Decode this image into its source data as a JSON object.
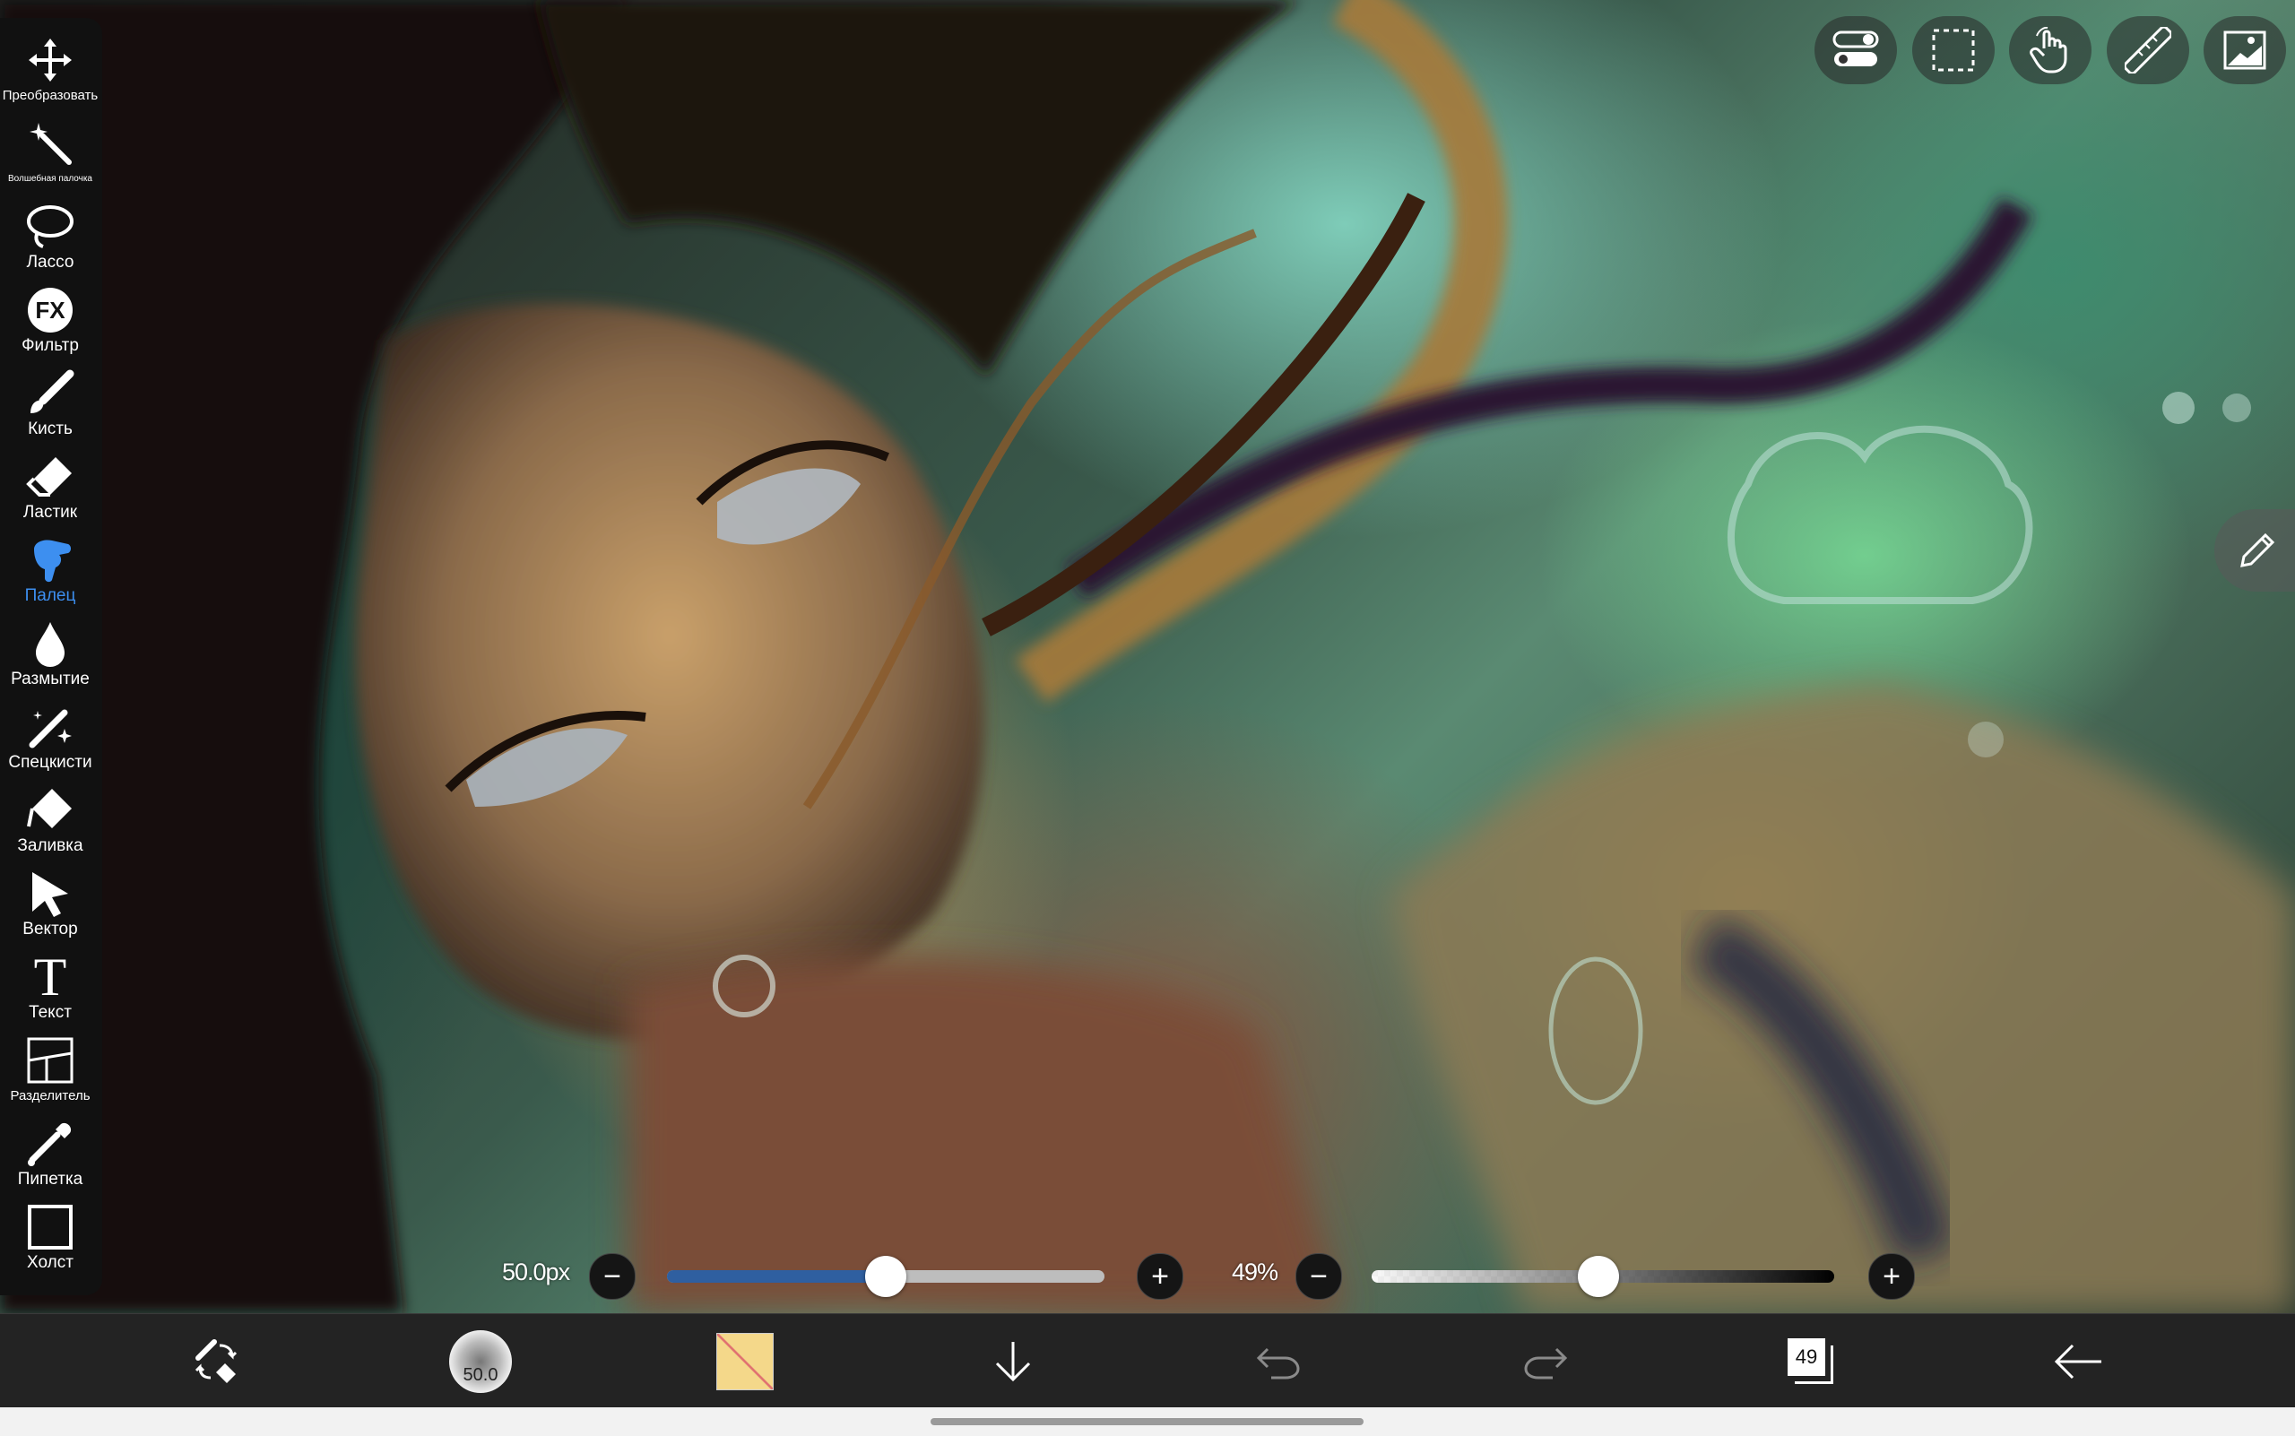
{
  "toolbar": {
    "tools": [
      {
        "label": "Преобразовать",
        "icon": "move-icon"
      },
      {
        "label": "Волшебная палочка",
        "icon": "magic-wand-icon"
      },
      {
        "label": "Лассо",
        "icon": "lasso-icon"
      },
      {
        "label": "Фильтр",
        "icon": "fx-icon",
        "icon_text": "FX"
      },
      {
        "label": "Кисть",
        "icon": "brush-icon"
      },
      {
        "label": "Ластик",
        "icon": "eraser-icon"
      },
      {
        "label": "Палец",
        "icon": "finger-icon",
        "active": true
      },
      {
        "label": "Размытие",
        "icon": "drop-icon"
      },
      {
        "label": "Спецкисти",
        "icon": "special-brush-icon"
      },
      {
        "label": "Заливка",
        "icon": "fill-icon"
      },
      {
        "label": "Вектор",
        "icon": "cursor-icon"
      },
      {
        "label": "Текст",
        "icon": "text-icon",
        "icon_text": "T"
      },
      {
        "label": "Разделитель",
        "icon": "divider-icon"
      },
      {
        "label": "Пипетка",
        "icon": "eyedropper-icon"
      },
      {
        "label": "Холст",
        "icon": "canvas-icon"
      }
    ]
  },
  "top_buttons": [
    "toggle-icon",
    "selection-icon",
    "touch-icon",
    "ruler-icon",
    "image-icon"
  ],
  "brush_size": {
    "value": "50.0px",
    "minus": "−",
    "plus": "+",
    "fill": 0.5
  },
  "opacity": {
    "value": "49%",
    "minus": "−",
    "plus": "+",
    "fill": 0.49
  },
  "bottom_bar": {
    "brush_preview_value": "50.0",
    "layers_count": "49"
  },
  "colors": {
    "accent": "#3d8ff0",
    "toolbar_bg": "#111111",
    "bottom_bg": "#232323"
  }
}
